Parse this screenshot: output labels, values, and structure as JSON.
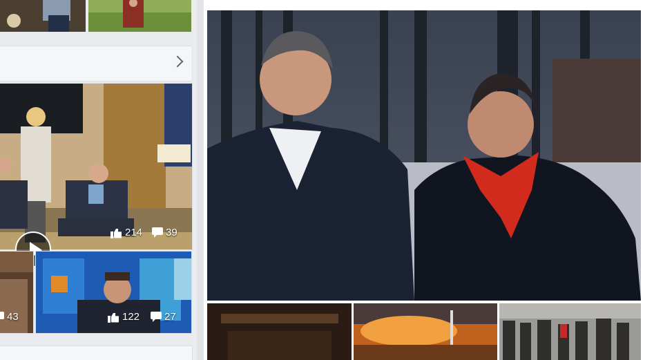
{
  "left_column": {
    "video_post": {
      "likes": "214",
      "comments": "39"
    },
    "small_post_left": {
      "likes": "43"
    },
    "small_post_right": {
      "likes": "122",
      "comments": "27"
    }
  },
  "icons": {
    "chevron": "chevron-right-icon",
    "play": "play-icon",
    "like": "thumbs-up-icon",
    "comment": "comment-icon"
  },
  "colors": {
    "page_bg": "#e9ebee",
    "card_bg": "#ffffff",
    "scarf_red": "#d22a1d"
  }
}
